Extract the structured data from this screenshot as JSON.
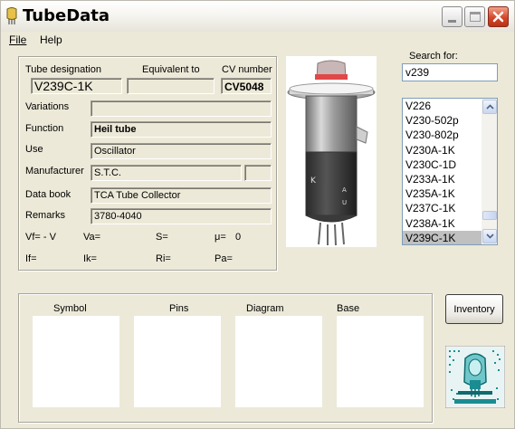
{
  "window": {
    "title": "TubeData"
  },
  "menu": {
    "file": "File",
    "help": "Help"
  },
  "tube": {
    "designation_label": "Tube designation",
    "designation": "V239C-1K",
    "equivalent_label": "Equivalent to",
    "equivalent": "",
    "cv_label": "CV number",
    "cv": "CV5048",
    "variations_label": "Variations",
    "variations": "",
    "function_label": "Function",
    "function": "Heil tube",
    "use_label": "Use",
    "use": "Oscillator",
    "manufacturer_label": "Manufacturer",
    "manufacturer": "S.T.C.",
    "manufacturer_extra": "",
    "databook_label": "Data book",
    "databook": "TCA Tube Collector",
    "remarks_label": "Remarks",
    "remarks": "3780-4040"
  },
  "params": {
    "vf": "Vf= - V",
    "va": "Va=",
    "s": "S=",
    "mu": "μ=",
    "mu_value": "0",
    "if": "If=",
    "ik": "Ik=",
    "ri": "Ri=",
    "pa": "Pa="
  },
  "search": {
    "label": "Search for:",
    "value": "v239",
    "results": [
      "V226",
      "V230-502p",
      "V230-802p",
      "V230A-1K",
      "V230C-1D",
      "V233A-1K",
      "V235A-1K",
      "V237C-1K",
      "V238A-1K",
      "V239C-1K"
    ],
    "selected": "V239C-1K"
  },
  "panes": {
    "symbol": "Symbol",
    "pins": "Pins",
    "diagram": "Diagram",
    "base": "Base"
  },
  "buttons": {
    "inventory": "Inventory"
  },
  "colors": {
    "window_bg": "#ece9d8",
    "close_red": "#d4462a",
    "selection": "#c0c0c0",
    "logo_teal": "#1a8c92"
  }
}
